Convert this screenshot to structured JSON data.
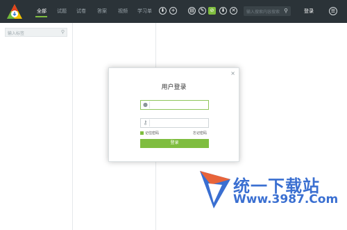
{
  "topbar": {
    "nav": [
      "全部",
      "试题",
      "试卷",
      "答案",
      "视频",
      "学习单"
    ],
    "tools": [
      "⬇",
      "+",
      "▤",
      "✎",
      "⊘",
      "⬇",
      "✕"
    ],
    "search_placeholder": "输入搜索内容搜索",
    "login": "登录",
    "menu_icon": "☰"
  },
  "sidebar": {
    "search_placeholder": "输入标签"
  },
  "dialog": {
    "title": "用户登录",
    "close": "×",
    "remember": "记住密码",
    "forgot": "忘记密码",
    "login_button": "登录"
  },
  "watermark": {
    "brand": "统一下载站",
    "url": "Www.3987.Com"
  },
  "colors": {
    "accent": "#7fbd3f",
    "topbar": "#2b3338",
    "watermark": "#3a6fd1"
  }
}
